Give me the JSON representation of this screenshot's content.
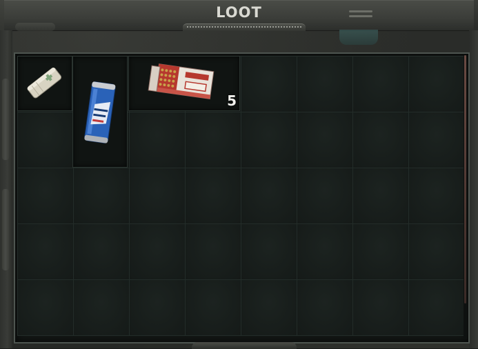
{
  "window": {
    "title": "LOOT"
  },
  "grid": {
    "columns": 8,
    "rows": 5
  },
  "items": [
    {
      "icon": "bandage-icon"
    },
    {
      "icon": "energy-drink-can-icon"
    },
    {
      "icon": "ammo-box-9x19-icon",
      "quantity": "5"
    }
  ],
  "colors": {
    "panel_background": "#141816",
    "cell_line": "#232c29",
    "accent_teal": "#3f6664"
  }
}
